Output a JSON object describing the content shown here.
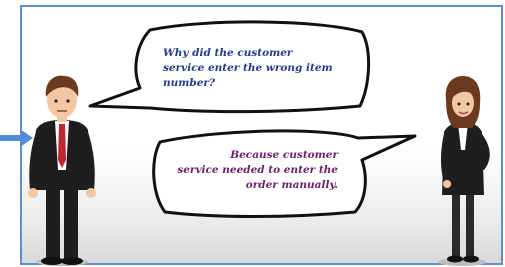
{
  "dialogue": {
    "question_lines": [
      "Why did the customer",
      "service enter the wrong item",
      "number?"
    ],
    "answer_lines": [
      "Because customer",
      "service needed to enter the",
      "order manually."
    ]
  },
  "colors": {
    "frame": "#5b8fd0",
    "question_text": "#1f3d8a",
    "answer_text": "#6e1d6e",
    "arrow": "#4f8ed6"
  },
  "icons": {
    "left_arrow": "right-arrow-icon",
    "man": "businessman-figure",
    "woman": "businesswoman-figure"
  }
}
